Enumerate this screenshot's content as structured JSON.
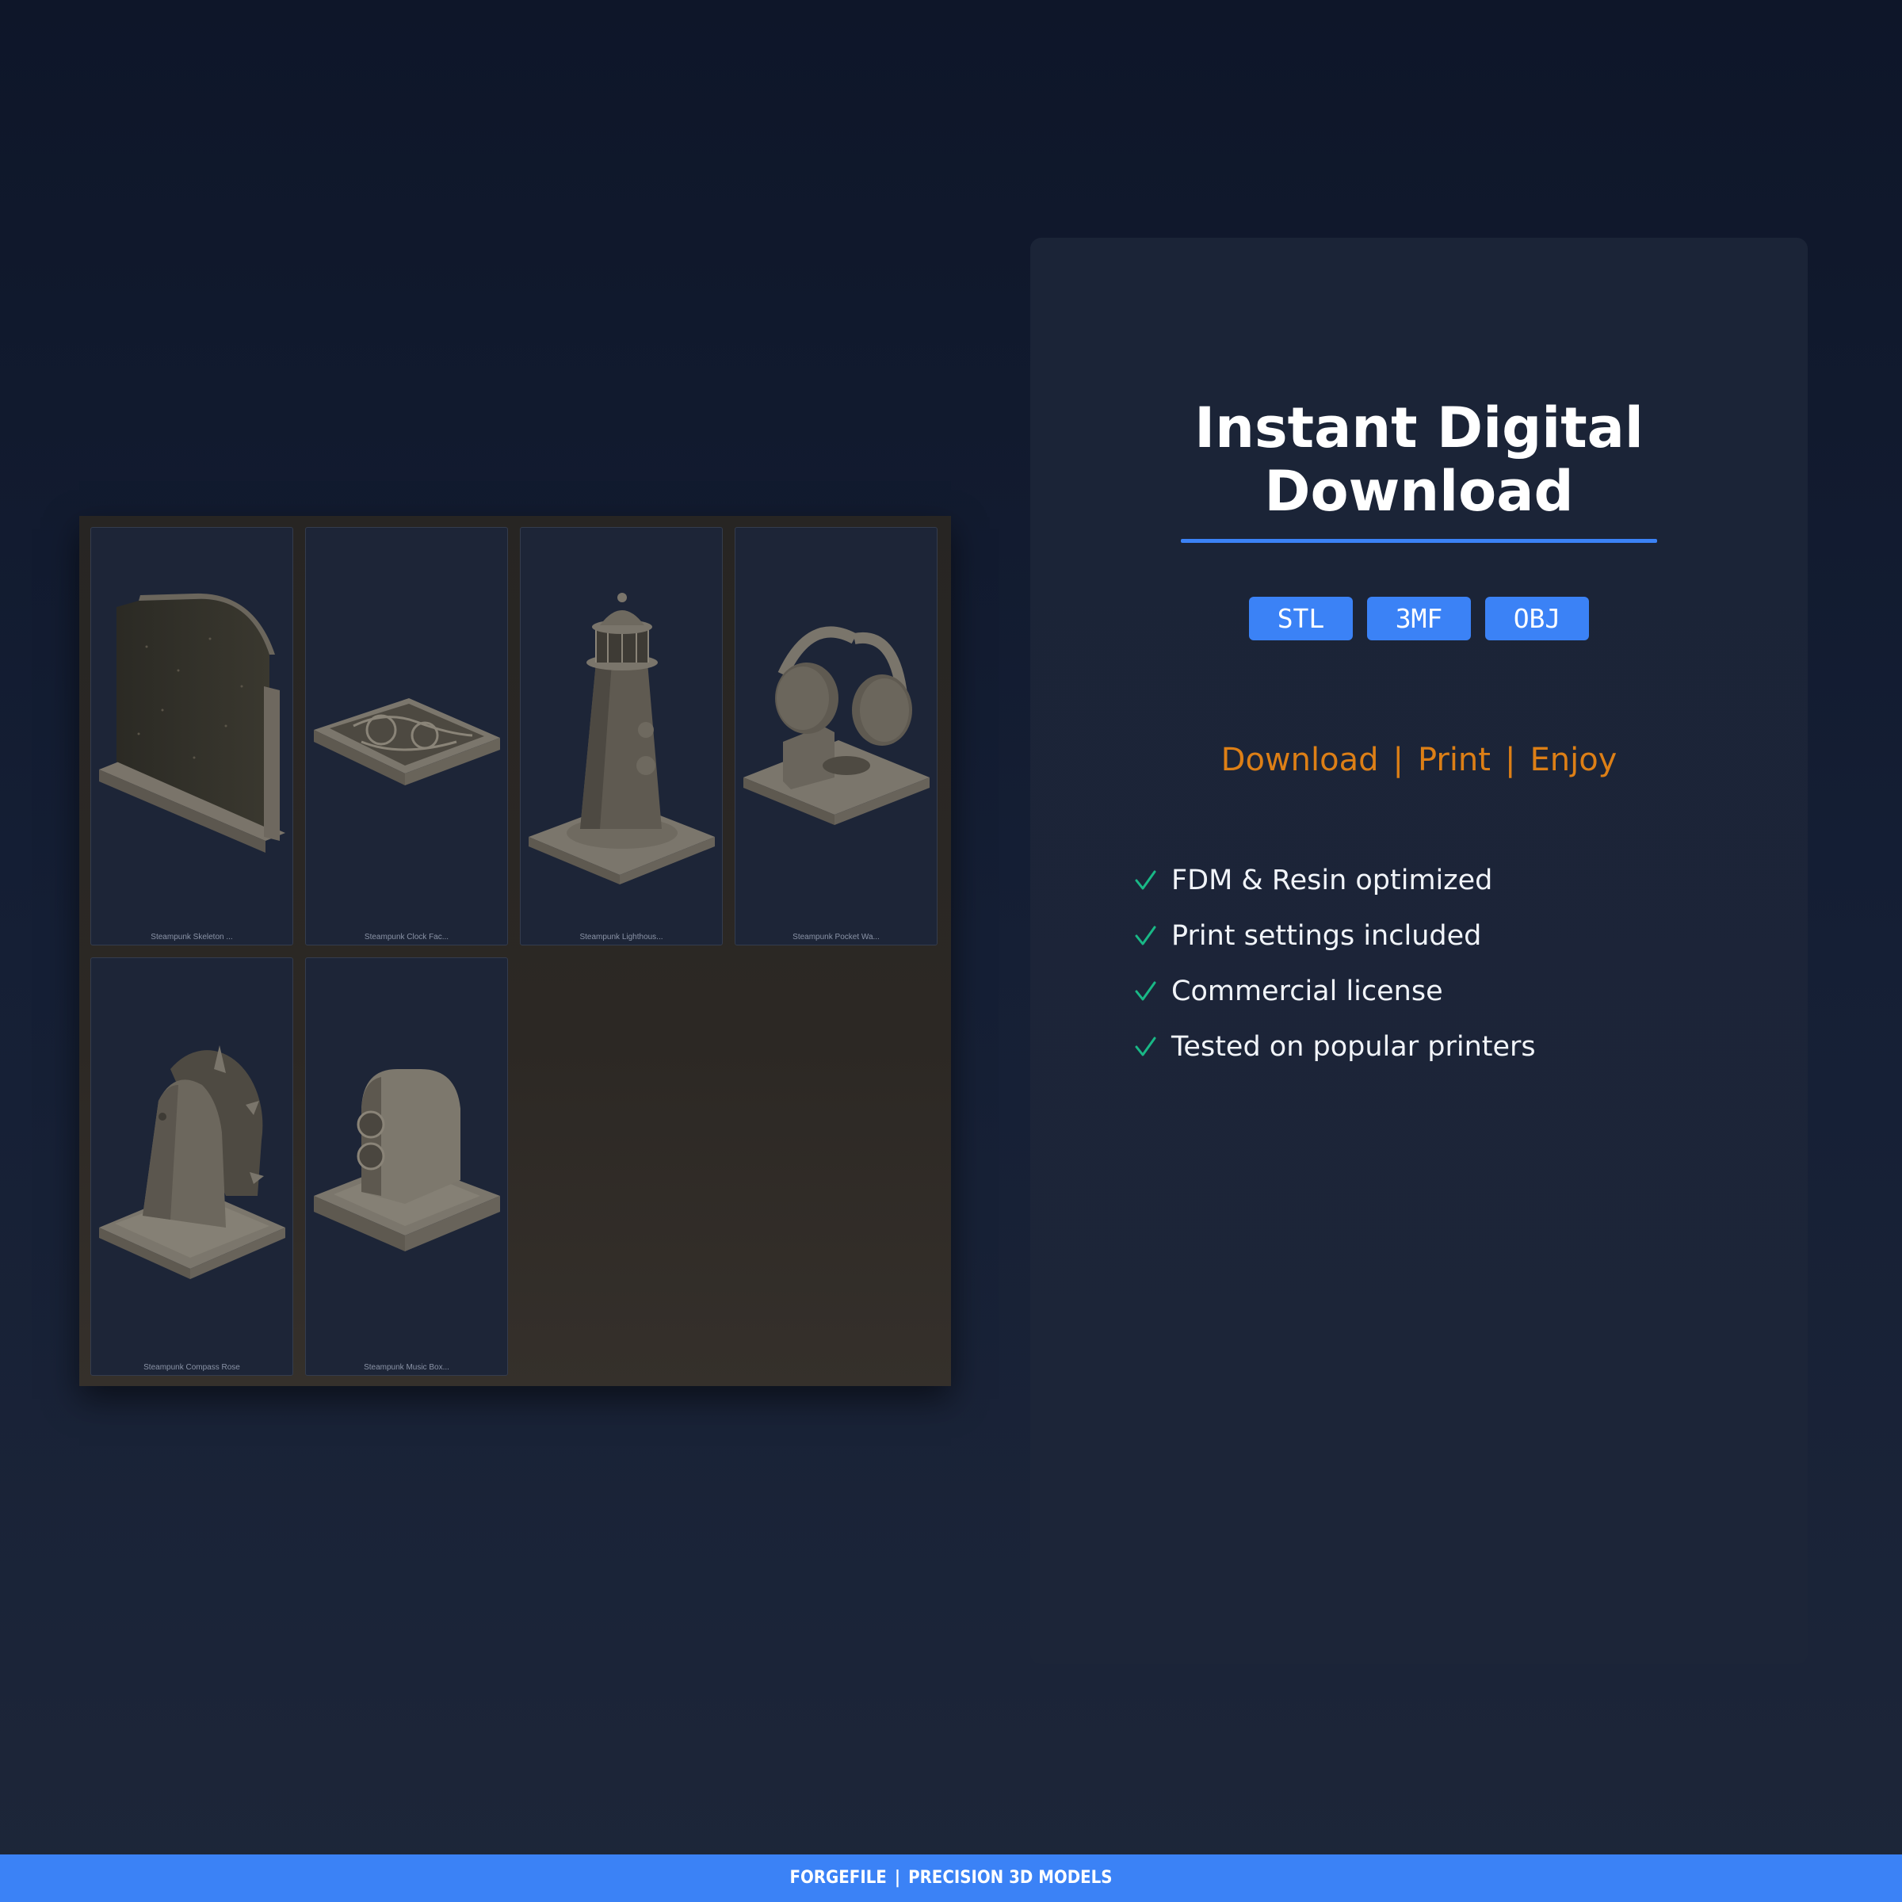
{
  "preview": {
    "cards": [
      {
        "caption": "Steampunk Skeleton ...",
        "icon": "skeleton-clock-model"
      },
      {
        "caption": "Steampunk Clock Fac...",
        "icon": "clock-face-tray-model"
      },
      {
        "caption": "Steampunk Lighthous...",
        "icon": "lighthouse-model"
      },
      {
        "caption": "Steampunk Pocket Wa...",
        "icon": "pocket-watch-stand-model"
      },
      {
        "caption": "Steampunk Compass Rose",
        "icon": "compass-rose-model"
      },
      {
        "caption": "Steampunk Music Box...",
        "icon": "music-box-model"
      }
    ]
  },
  "panel": {
    "title_line1": "Instant Digital",
    "title_line2": "Download",
    "formats": [
      "STL",
      "3MF",
      "OBJ"
    ],
    "tagline": [
      "Download",
      "Print",
      "Enjoy"
    ],
    "tagline_separator": "|",
    "features": [
      "FDM & Resin optimized",
      "Print settings included",
      "Commercial license",
      "Tested on popular printers"
    ],
    "check_icon": "check-icon"
  },
  "footer": {
    "brand": "FORGEFILE",
    "separator": "|",
    "slogan": "PRECISION 3D MODELS"
  },
  "colors": {
    "accent_blue": "#3b82f6",
    "accent_orange": "#dd7f16",
    "check_green": "#19b886",
    "background": "#0e1629",
    "panel": "#1b2437"
  }
}
